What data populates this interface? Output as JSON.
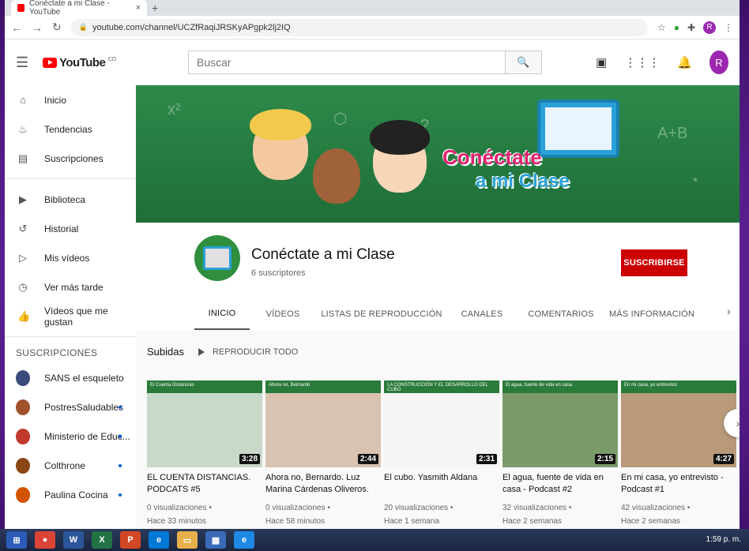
{
  "browser": {
    "tab_title": "Conéctate a mi Clase - YouTube",
    "tab_close": "×",
    "new_tab": "+",
    "url": "youtube.com/channel/UCZfRaqiJRSKyAPgpk2lj2IQ",
    "profile_initial": "R"
  },
  "header": {
    "logo_text": "YouTube",
    "logo_suffix": "CO",
    "search_placeholder": "Buscar",
    "avatar_initial": "R"
  },
  "sidebar": {
    "main": [
      {
        "label": "Inicio",
        "icon": "home-icon",
        "glyph": "⌂"
      },
      {
        "label": "Tendencias",
        "icon": "flame-icon",
        "glyph": "♨"
      },
      {
        "label": "Suscripciones",
        "icon": "subscriptions-icon",
        "glyph": "▤"
      }
    ],
    "library": [
      {
        "label": "Biblioteca",
        "icon": "library-icon",
        "glyph": "▶"
      },
      {
        "label": "Historial",
        "icon": "history-icon",
        "glyph": "↺"
      },
      {
        "label": "Mis vídeos",
        "icon": "my-videos-icon",
        "glyph": "▷"
      },
      {
        "label": "Ver más tarde",
        "icon": "watch-later-icon",
        "glyph": "◷"
      },
      {
        "label": "Vídeos que me gustan",
        "icon": "like-icon",
        "glyph": "👍"
      }
    ],
    "subscriptions_heading": "SUSCRIPCIONES",
    "subscriptions": [
      {
        "label": "SANS el esqueleto",
        "color": "#3a4a7a",
        "dot": false
      },
      {
        "label": "PostresSaludables",
        "color": "#a0522d",
        "dot": true
      },
      {
        "label": "Ministerio de Educ...",
        "color": "#c0392b",
        "dot": true
      },
      {
        "label": "Colthrone",
        "color": "#8b4513",
        "dot": true
      },
      {
        "label": "Paulina Cocina",
        "color": "#d35400",
        "dot": true
      }
    ]
  },
  "channel": {
    "name": "Conéctate a mi Clase",
    "subscribers": "6 suscriptores",
    "subscribe_label": "SUSCRIBIRSE",
    "banner_line1": "Conéctate",
    "banner_line2": "a mi Clase",
    "tabs": [
      "INICIO",
      "VÍDEOS",
      "LISTAS DE REPRODUCCIÓN",
      "CANALES",
      "COMENTARIOS",
      "MÁS INFORMACIÓN"
    ],
    "active_tab": "INICIO",
    "uploads_label": "Subidas",
    "play_all_label": "REPRODUCIR TODO"
  },
  "videos": [
    {
      "title": "EL CUENTA DISTANCIAS. PODCATS #5",
      "views": "0 visualizaciones •",
      "age": "Hace 33 minutos",
      "duration": "3:28",
      "thumb_caption": "El Cuenta Distancias",
      "thumb_bg": "#c9d9c9"
    },
    {
      "title": "Ahora no, Bernardo. Luz Marina Cárdenas Oliveros.",
      "views": "0 visualizaciones •",
      "age": "Hace 58 minutos",
      "duration": "2:44",
      "thumb_caption": "Ahora no, Bernardo",
      "thumb_bg": "#d9c2b0"
    },
    {
      "title": "El cubo. Yasmith Aldana",
      "views": "20 visualizaciones •",
      "age": "Hace 1 semana",
      "duration": "2:31",
      "thumb_caption": "LA CONSTRUCCIÓN Y EL DESARROLLO DEL CUBO",
      "thumb_bg": "#f4f4f4"
    },
    {
      "title": "El agua, fuente de vida en casa - Podcast #2",
      "views": "32 visualizaciones •",
      "age": "Hace 2 semanas",
      "duration": "2:15",
      "thumb_caption": "El agua, fuente de vida en casa",
      "thumb_bg": "#7a9a6a"
    },
    {
      "title": "En mi casa, yo entrevisto - Podcast #1",
      "views": "42 visualizaciones •",
      "age": "Hace 2 semanas",
      "duration": "4:27",
      "thumb_caption": "En mi casa, yo entrevisto",
      "thumb_bg": "#b89a7a"
    }
  ],
  "taskbar": {
    "clock": "1:59 p. m."
  }
}
